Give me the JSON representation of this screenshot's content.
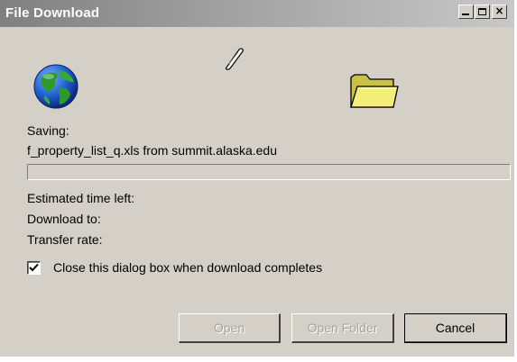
{
  "window": {
    "title": "File Download",
    "caption_buttons": {
      "minimize_icon": "minimize-icon",
      "maximize_icon": "maximize-icon",
      "close_glyph": "×"
    }
  },
  "icons": {
    "globe": "globe-icon",
    "paper": "flying-paper-icon",
    "folder": "folder-icon"
  },
  "saving": {
    "label": "Saving:",
    "file": "f_property_list_q.xls from summit.alaska.edu"
  },
  "progress": {
    "fraction": 0
  },
  "info": {
    "time_left_label": "Estimated time left:",
    "download_to_label": "Download to:",
    "transfer_rate_label": "Transfer rate:"
  },
  "close_option": {
    "label": "Close this dialog box when download completes",
    "checked": true
  },
  "buttons": {
    "open": "Open",
    "open_folder": "Open Folder",
    "cancel": "Cancel"
  },
  "colors": {
    "face": "#d4d0c8",
    "title_gradient_start": "#808080",
    "title_gradient_end": "#c8c8c8",
    "disabled_text": "#a6a39b"
  }
}
